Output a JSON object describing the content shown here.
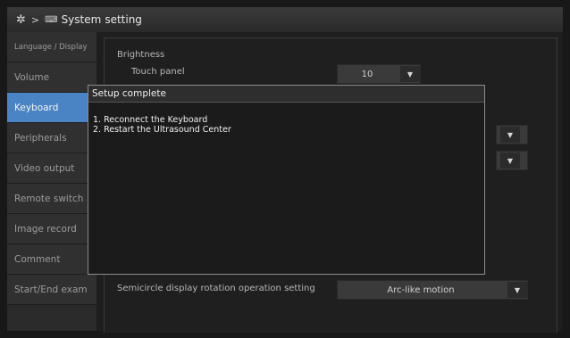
{
  "header": {
    "gear_icon": "gear-icon",
    "separator": ">",
    "keyboard_icon": "⌨",
    "title_partial": "System",
    "title_rest": "setting"
  },
  "sidebar": {
    "items": [
      {
        "label": "Language / Display",
        "active": false
      },
      {
        "label": "Volume",
        "active": false
      },
      {
        "label": "Keyboard",
        "active": true
      },
      {
        "label": "Peripherals",
        "active": false
      },
      {
        "label": "Video output",
        "active": false
      },
      {
        "label": "Remote switch",
        "active": false
      },
      {
        "label": "Image record",
        "active": false
      },
      {
        "label": "Comment",
        "active": false
      },
      {
        "label": "Start/End exam",
        "active": false
      }
    ]
  },
  "main": {
    "brightness_heading": "Brightness",
    "touch_panel_label": "Touch panel",
    "touch_panel_value": "10",
    "semicircle_label": "Semicircle display rotation operation setting",
    "semicircle_value": "Arc-like motion"
  },
  "dialog": {
    "title": "Setup complete",
    "line1": "1. Reconnect the Keyboard",
    "line2": "2. Restart the Ultrasound Center"
  },
  "colors": {
    "active_item": "#4a84c4",
    "background": "#1d1d1d"
  }
}
